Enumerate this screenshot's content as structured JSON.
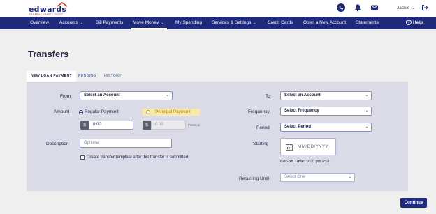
{
  "brand": {
    "name": "edwards",
    "tagline": "FEDERAL CREDIT UNION",
    "primary_color": "#1f2a7a",
    "accent_color": "#c0392b"
  },
  "header": {
    "icons": [
      "phone-icon",
      "bell-icon",
      "mail-icon",
      "logout-icon"
    ],
    "user_name": "Jackie"
  },
  "nav": {
    "items": [
      {
        "label": "Overview",
        "has_dropdown": false
      },
      {
        "label": "Accounts",
        "has_dropdown": true
      },
      {
        "label": "Bill Payments",
        "has_dropdown": false
      },
      {
        "label": "Move Money",
        "has_dropdown": true,
        "active": true
      },
      {
        "label": "My Spending",
        "has_dropdown": false
      },
      {
        "label": "Services & Settings",
        "has_dropdown": true
      },
      {
        "label": "Credit Cards",
        "has_dropdown": false
      },
      {
        "label": "Open a New Account",
        "has_dropdown": false
      },
      {
        "label": "Statements",
        "has_dropdown": false
      }
    ],
    "help_label": "Help"
  },
  "page": {
    "title": "Transfers"
  },
  "tabs": [
    {
      "label": "NEW LOAN PAYMENT",
      "active": true
    },
    {
      "label": "PENDING",
      "active": false
    },
    {
      "label": "HISTORY",
      "active": false
    }
  ],
  "form": {
    "from_label": "From",
    "from_value": "Select an Account",
    "amount_label": "Amount",
    "regular_payment_label": "Regular Payment",
    "regular_payment_selected": true,
    "principal_payment_label": "Principal Payment",
    "principal_payment_selected": false,
    "currency_symbol": "$",
    "regular_amount": "0.00",
    "principal_amount": "0.00",
    "principal_note": "Principal",
    "description_label": "Description",
    "description_placeholder": "Optional",
    "template_checkbox_label": "Create transfer template after this transfer is submitted.",
    "template_checked": false,
    "to_label": "To",
    "to_value": "Select an Account",
    "frequency_label": "Frequency",
    "frequency_value": "Select Frequency",
    "period_label": "Period",
    "period_value": "Select Period",
    "starting_label": "Starting",
    "date_placeholder": "MM/DD/YYYY",
    "cutoff_label": "Cut-off Time:",
    "cutoff_value": "9:00 pm PST",
    "recurring_until_label": "Recurring Until",
    "recurring_until_value": "Select One"
  },
  "actions": {
    "continue_label": "Continue"
  }
}
